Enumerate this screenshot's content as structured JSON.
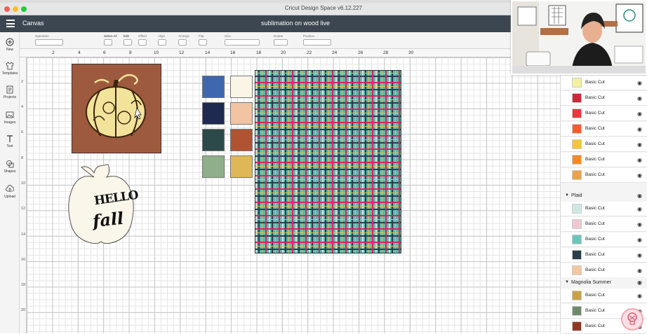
{
  "window": {
    "title": "Cricut Design Space  v6.12.227"
  },
  "header": {
    "canvas_label": "Canvas",
    "project_name": "sublimation on wood live"
  },
  "toolbar": {
    "items": [
      "Operation",
      "Select All",
      "Edit",
      "Offset",
      "Align",
      "Arrange",
      "Flip",
      "Size",
      "Rotate",
      "Position"
    ]
  },
  "sidebar": {
    "items": [
      {
        "label": "New",
        "icon": "plus-icon"
      },
      {
        "label": "Templates",
        "icon": "shirt-icon"
      },
      {
        "label": "Projects",
        "icon": "projects-icon"
      },
      {
        "label": "Images",
        "icon": "images-icon"
      },
      {
        "label": "Text",
        "icon": "text-icon"
      },
      {
        "label": "Shapes",
        "icon": "shapes-icon"
      },
      {
        "label": "Upload",
        "icon": "upload-icon"
      }
    ]
  },
  "ruler": {
    "top": [
      "2",
      "4",
      "6",
      "8",
      "10",
      "12",
      "14",
      "16",
      "18",
      "20",
      "22",
      "24",
      "26",
      "28",
      "30"
    ],
    "left": [
      "2",
      "4",
      "6",
      "8",
      "10",
      "12",
      "14",
      "16",
      "18",
      "20"
    ]
  },
  "canvas": {
    "hello_text_1": "HELLO",
    "hello_text_2": "fall",
    "swatches": [
      "#3f67b0",
      "#fbf5e6",
      "#1e2a50",
      "#f2c4a3",
      "#2c4a4a",
      "#b05333",
      "#8faf8a",
      "#dfb757"
    ]
  },
  "layers": {
    "top_rows": [
      {
        "label": "Basic Cut",
        "color": "#f3f0a0"
      },
      {
        "label": "Basic Cut",
        "color": "#c92a3a"
      },
      {
        "label": "Basic Cut",
        "color": "#e8383c"
      },
      {
        "label": "Basic Cut",
        "color": "#ef5e34"
      },
      {
        "label": "Basic Cut",
        "color": "#f6c43c"
      },
      {
        "label": "Basic Cut",
        "color": "#f28a2c"
      },
      {
        "label": "Basic Cut",
        "color": "#e8a24a"
      }
    ],
    "group_plaid": "Plaid",
    "plaid_rows": [
      {
        "label": "Basic Cut",
        "color": "#cfe8e4"
      },
      {
        "label": "Basic Cut",
        "color": "#f0c9d0"
      },
      {
        "label": "Basic Cut",
        "color": "#6cc5b9"
      },
      {
        "label": "Basic Cut",
        "color": "#2a3e4a"
      },
      {
        "label": "Basic Cut",
        "color": "#f2c8a0"
      }
    ],
    "group_magnolia": "Magnolia Summer",
    "magnolia_rows": [
      {
        "label": "Basic Cut",
        "color": "#c9a14a"
      },
      {
        "label": "Basic Cut",
        "color": "#6f8a6a"
      },
      {
        "label": "Basic Cut",
        "color": "#8a3c24"
      }
    ]
  }
}
